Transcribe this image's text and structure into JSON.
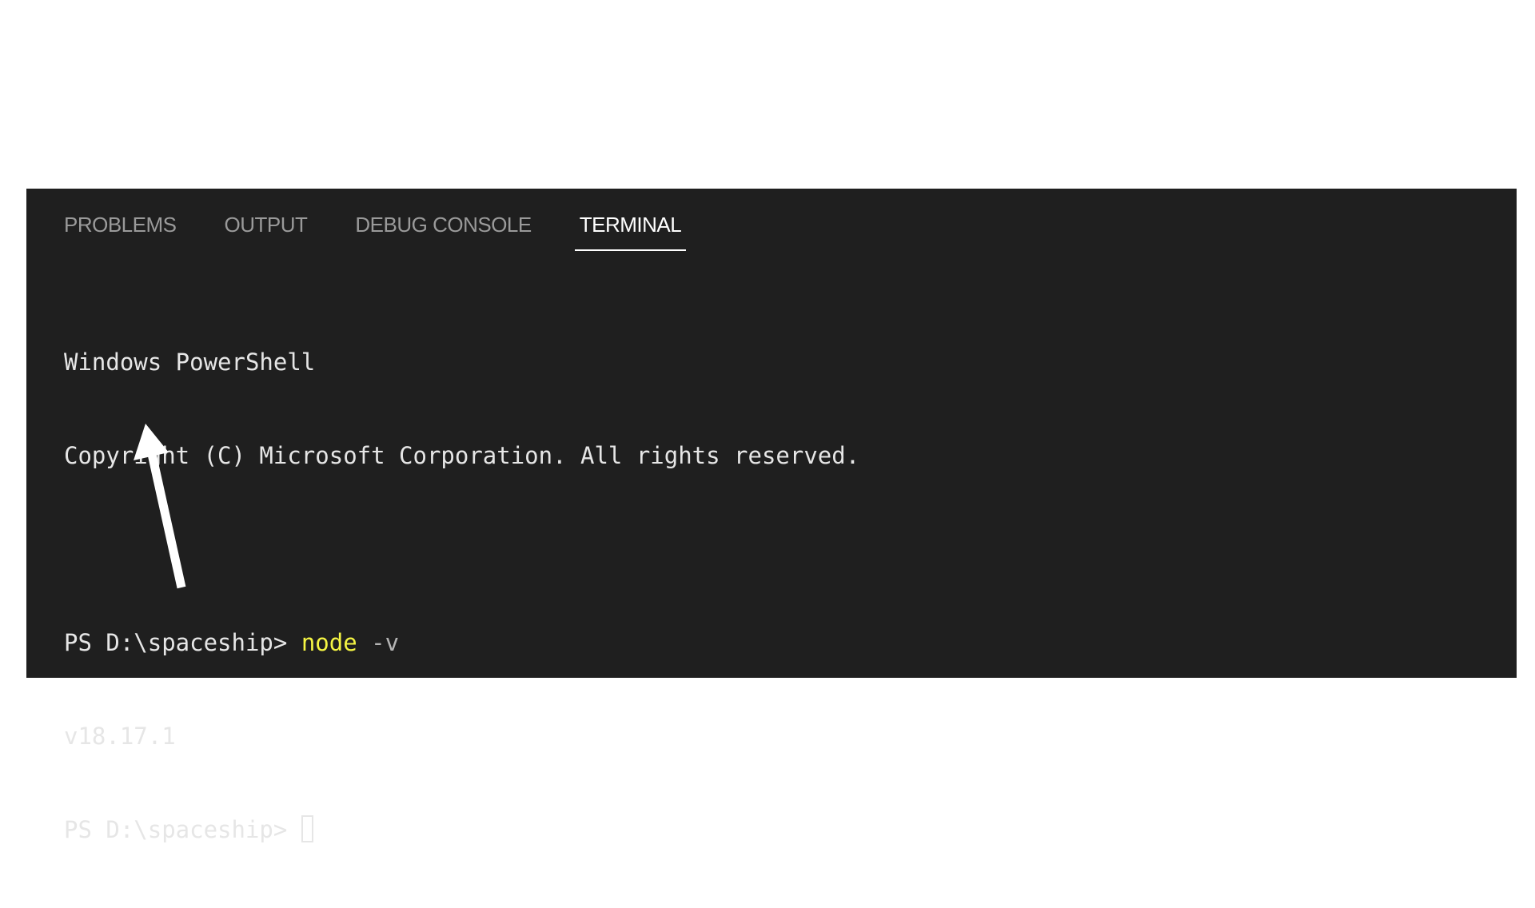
{
  "panel": {
    "tabs": [
      {
        "label": "PROBLEMS",
        "active": false
      },
      {
        "label": "OUTPUT",
        "active": false
      },
      {
        "label": "DEBUG CONSOLE",
        "active": false
      },
      {
        "label": "TERMINAL",
        "active": true
      }
    ]
  },
  "terminal": {
    "header_line1": "Windows PowerShell",
    "header_line2": "Copyright (C) Microsoft Corporation. All rights reserved.",
    "prompt1": "PS D:\\spaceship> ",
    "command": "node",
    "command_args": " -v",
    "output": "v18.17.1",
    "prompt2": "PS D:\\spaceship> "
  },
  "colors": {
    "panel_background": "#1f1f1f",
    "command_highlight": "#f5f543",
    "arrow": "#ffffff"
  },
  "annotation": {
    "icon": "arrow-up-icon"
  }
}
